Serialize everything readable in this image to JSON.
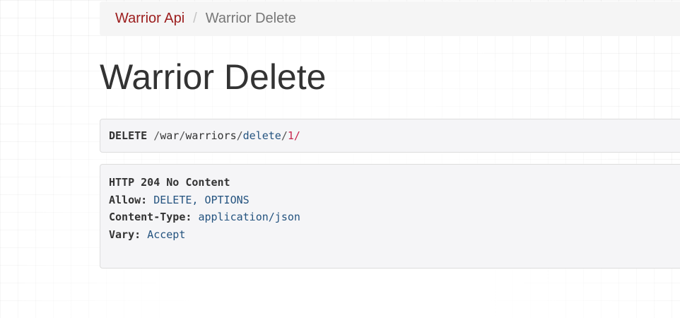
{
  "breadcrumb": {
    "items": [
      {
        "label": "Warrior Api"
      },
      {
        "label": "Warrior Delete"
      }
    ],
    "separator": "/"
  },
  "page_title": "Warrior Delete",
  "request": {
    "method": "DELETE",
    "path_segments": [
      "war",
      "warriors",
      "delete",
      "1"
    ]
  },
  "response": {
    "status_line": "HTTP 204 No Content",
    "headers": [
      {
        "key": "Allow:",
        "value": "DELETE, OPTIONS"
      },
      {
        "key": "Content-Type:",
        "value": "application/json"
      },
      {
        "key": "Vary:",
        "value": "Accept"
      }
    ]
  },
  "colors": {
    "link": "#9b1c1c",
    "header_value": "#24537f",
    "id_highlight": "#c7254e",
    "panel_bg": "#f5f5f7"
  }
}
